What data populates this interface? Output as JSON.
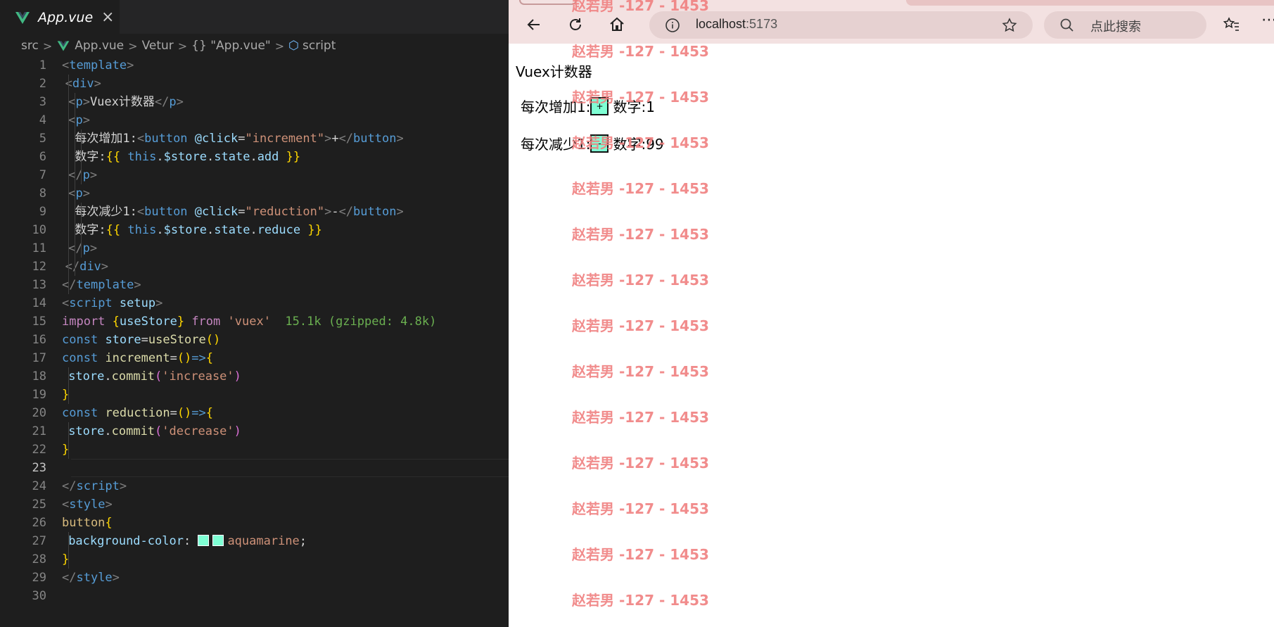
{
  "editor": {
    "tab": {
      "title": "App.vue",
      "close": "×"
    },
    "breadcrumb": {
      "folder": "src",
      "file": "App.vue",
      "ext": "Vetur",
      "obj": "{} \"App.vue\"",
      "symbol": "script",
      "sep": ">"
    },
    "active_line": 23,
    "lines": [
      {
        "n": "1",
        "indent": 0,
        "tokens": [
          [
            "t-tag",
            "<"
          ],
          [
            "t-name",
            "template"
          ],
          [
            "t-tag",
            ">"
          ]
        ]
      },
      {
        "n": "2",
        "indent": 1,
        "tokens": [
          [
            "t-tag",
            "<"
          ],
          [
            "t-name",
            "div"
          ],
          [
            "t-tag",
            ">"
          ]
        ]
      },
      {
        "n": "3",
        "indent": 2,
        "tokens": [
          [
            "t-tag",
            "<"
          ],
          [
            "t-name",
            "p"
          ],
          [
            "t-tag",
            ">"
          ],
          [
            "t-txt",
            "Vuex计数器"
          ],
          [
            "t-tag",
            "</"
          ],
          [
            "t-name",
            "p"
          ],
          [
            "t-tag",
            ">"
          ]
        ]
      },
      {
        "n": "4",
        "indent": 2,
        "tokens": [
          [
            "t-tag",
            "<"
          ],
          [
            "t-name",
            "p"
          ],
          [
            "t-tag",
            ">"
          ]
        ]
      },
      {
        "n": "5",
        "indent": 4,
        "tokens": [
          [
            "t-txt",
            "每次增加1:"
          ],
          [
            "t-tag",
            "<"
          ],
          [
            "t-name",
            "button"
          ],
          [
            "t-txt",
            " "
          ],
          [
            "t-attr",
            "@click"
          ],
          [
            "t-txt",
            "="
          ],
          [
            "t-str",
            "\"increment\""
          ],
          [
            "t-tag",
            ">"
          ],
          [
            "t-txt",
            "+"
          ],
          [
            "t-tag",
            "</"
          ],
          [
            "t-name",
            "button"
          ],
          [
            "t-tag",
            ">"
          ]
        ]
      },
      {
        "n": "6",
        "indent": 4,
        "tokens": [
          [
            "t-txt",
            "数字:"
          ],
          [
            "t-brace",
            "{{"
          ],
          [
            "t-txt",
            " "
          ],
          [
            "t-kw",
            "this"
          ],
          [
            "t-txt",
            "."
          ],
          [
            "t-var",
            "$store"
          ],
          [
            "t-txt",
            "."
          ],
          [
            "t-var",
            "state"
          ],
          [
            "t-txt",
            "."
          ],
          [
            "t-var",
            "add"
          ],
          [
            "t-txt",
            " "
          ],
          [
            "t-brace",
            "}}"
          ]
        ]
      },
      {
        "n": "7",
        "indent": 2,
        "tokens": [
          [
            "t-tag",
            "</"
          ],
          [
            "t-name",
            "p"
          ],
          [
            "t-tag",
            ">"
          ]
        ]
      },
      {
        "n": "8",
        "indent": 2,
        "tokens": [
          [
            "t-tag",
            "<"
          ],
          [
            "t-name",
            "p"
          ],
          [
            "t-tag",
            ">"
          ]
        ]
      },
      {
        "n": "9",
        "indent": 4,
        "tokens": [
          [
            "t-txt",
            "每次减少1:"
          ],
          [
            "t-tag",
            "<"
          ],
          [
            "t-name",
            "button"
          ],
          [
            "t-txt",
            " "
          ],
          [
            "t-attr",
            "@click"
          ],
          [
            "t-txt",
            "="
          ],
          [
            "t-str",
            "\"reduction\""
          ],
          [
            "t-tag",
            ">"
          ],
          [
            "t-txt",
            "-"
          ],
          [
            "t-tag",
            "</"
          ],
          [
            "t-name",
            "button"
          ],
          [
            "t-tag",
            ">"
          ]
        ]
      },
      {
        "n": "10",
        "indent": 4,
        "tokens": [
          [
            "t-txt",
            "数字:"
          ],
          [
            "t-brace",
            "{{"
          ],
          [
            "t-txt",
            " "
          ],
          [
            "t-kw",
            "this"
          ],
          [
            "t-txt",
            "."
          ],
          [
            "t-var",
            "$store"
          ],
          [
            "t-txt",
            "."
          ],
          [
            "t-var",
            "state"
          ],
          [
            "t-txt",
            "."
          ],
          [
            "t-var",
            "reduce"
          ],
          [
            "t-txt",
            " "
          ],
          [
            "t-brace",
            "}}"
          ]
        ]
      },
      {
        "n": "11",
        "indent": 2,
        "tokens": [
          [
            "t-tag",
            "</"
          ],
          [
            "t-name",
            "p"
          ],
          [
            "t-tag",
            ">"
          ]
        ]
      },
      {
        "n": "12",
        "indent": 1,
        "tokens": [
          [
            "t-tag",
            "</"
          ],
          [
            "t-name",
            "div"
          ],
          [
            "t-tag",
            ">"
          ]
        ]
      },
      {
        "n": "13",
        "indent": 0,
        "tokens": [
          [
            "t-tag",
            "</"
          ],
          [
            "t-name",
            "template"
          ],
          [
            "t-tag",
            ">"
          ]
        ]
      },
      {
        "n": "14",
        "indent": 0,
        "tokens": [
          [
            "t-tag",
            "<"
          ],
          [
            "t-name",
            "script"
          ],
          [
            "t-txt",
            " "
          ],
          [
            "t-attr",
            "setup"
          ],
          [
            "t-tag",
            ">"
          ]
        ]
      },
      {
        "n": "15",
        "indent": 0,
        "tokens": [
          [
            "t-import",
            "import"
          ],
          [
            "t-txt",
            " "
          ],
          [
            "t-brace",
            "{"
          ],
          [
            "t-var",
            "useStore"
          ],
          [
            "t-brace",
            "}"
          ],
          [
            "t-txt",
            " "
          ],
          [
            "t-import",
            "from"
          ],
          [
            "t-txt",
            " "
          ],
          [
            "t-str",
            "'vuex'"
          ],
          [
            "t-txt",
            "  "
          ],
          [
            "t-size",
            "15.1k (gzipped: 4.8k)"
          ]
        ]
      },
      {
        "n": "16",
        "indent": 0,
        "tokens": [
          [
            "t-kw",
            "const"
          ],
          [
            "t-txt",
            " "
          ],
          [
            "t-var",
            "store"
          ],
          [
            "t-op",
            "="
          ],
          [
            "t-fn",
            "useStore"
          ],
          [
            "t-brace",
            "()"
          ]
        ]
      },
      {
        "n": "17",
        "indent": 0,
        "tokens": [
          [
            "t-kw",
            "const"
          ],
          [
            "t-txt",
            " "
          ],
          [
            "t-fn",
            "increment"
          ],
          [
            "t-op",
            "="
          ],
          [
            "t-brace",
            "()"
          ],
          [
            "t-kw",
            "=>"
          ],
          [
            "t-brace",
            "{"
          ]
        ]
      },
      {
        "n": "18",
        "indent": 2,
        "tokens": [
          [
            "t-var",
            "store"
          ],
          [
            "t-txt",
            "."
          ],
          [
            "t-fn",
            "commit"
          ],
          [
            "t-par",
            "("
          ],
          [
            "t-str",
            "'increase'"
          ],
          [
            "t-par",
            ")"
          ]
        ]
      },
      {
        "n": "19",
        "indent": 0,
        "tokens": [
          [
            "t-brace",
            "}"
          ]
        ]
      },
      {
        "n": "20",
        "indent": 0,
        "tokens": [
          [
            "t-kw",
            "const"
          ],
          [
            "t-txt",
            " "
          ],
          [
            "t-fn",
            "reduction"
          ],
          [
            "t-op",
            "="
          ],
          [
            "t-brace",
            "()"
          ],
          [
            "t-kw",
            "=>"
          ],
          [
            "t-brace",
            "{"
          ]
        ]
      },
      {
        "n": "21",
        "indent": 2,
        "tokens": [
          [
            "t-var",
            "store"
          ],
          [
            "t-txt",
            "."
          ],
          [
            "t-fn",
            "commit"
          ],
          [
            "t-par",
            "("
          ],
          [
            "t-str",
            "'decrease'"
          ],
          [
            "t-par",
            ")"
          ]
        ]
      },
      {
        "n": "22",
        "indent": 0,
        "tokens": [
          [
            "t-brace",
            "}"
          ]
        ]
      },
      {
        "n": "23",
        "indent": 0,
        "tokens": []
      },
      {
        "n": "24",
        "indent": 0,
        "tokens": [
          [
            "t-tag",
            "</"
          ],
          [
            "t-name",
            "script"
          ],
          [
            "t-tag",
            ">"
          ]
        ]
      },
      {
        "n": "25",
        "indent": 0,
        "tokens": [
          [
            "t-tag",
            "<"
          ],
          [
            "t-name",
            "style"
          ],
          [
            "t-tag",
            ">"
          ]
        ]
      },
      {
        "n": "26",
        "indent": 0,
        "tokens": [
          [
            "t-sel",
            "button"
          ],
          [
            "t-brace",
            "{"
          ]
        ]
      },
      {
        "n": "27",
        "indent": 2,
        "tokens": [
          [
            "t-var",
            "background-color"
          ],
          [
            "t-txt",
            ": "
          ],
          [
            "swatch",
            ""
          ],
          [
            "swatch",
            ""
          ],
          [
            "t-str",
            "aquamarine"
          ],
          [
            "t-txt",
            ";"
          ]
        ]
      },
      {
        "n": "28",
        "indent": 0,
        "tokens": [
          [
            "t-brace",
            "}"
          ]
        ]
      },
      {
        "n": "29",
        "indent": 0,
        "tokens": [
          [
            "t-tag",
            "</"
          ],
          [
            "t-name",
            "style"
          ],
          [
            "t-tag",
            ">"
          ]
        ]
      },
      {
        "n": "30",
        "indent": 0,
        "tokens": []
      }
    ]
  },
  "browser": {
    "url_host": "localhost",
    "url_port": ":5173",
    "search_placeholder": "点此搜索",
    "page": {
      "title": "Vuex计数器",
      "add_row": {
        "label": "每次增加1:",
        "button": "+",
        "value_label": "数字:1"
      },
      "reduce_row": {
        "label": "每次减少1:",
        "button": "-",
        "value_label": "数字:99"
      }
    },
    "watermark_text": "赵若男 -127 - 1453",
    "watermark_count": 14
  },
  "colors": {
    "button_bg": "#7fffd4",
    "watermark": "#f08080",
    "editor_bg": "#1e1e1e",
    "browser_chrome": "#f3e1e1"
  }
}
